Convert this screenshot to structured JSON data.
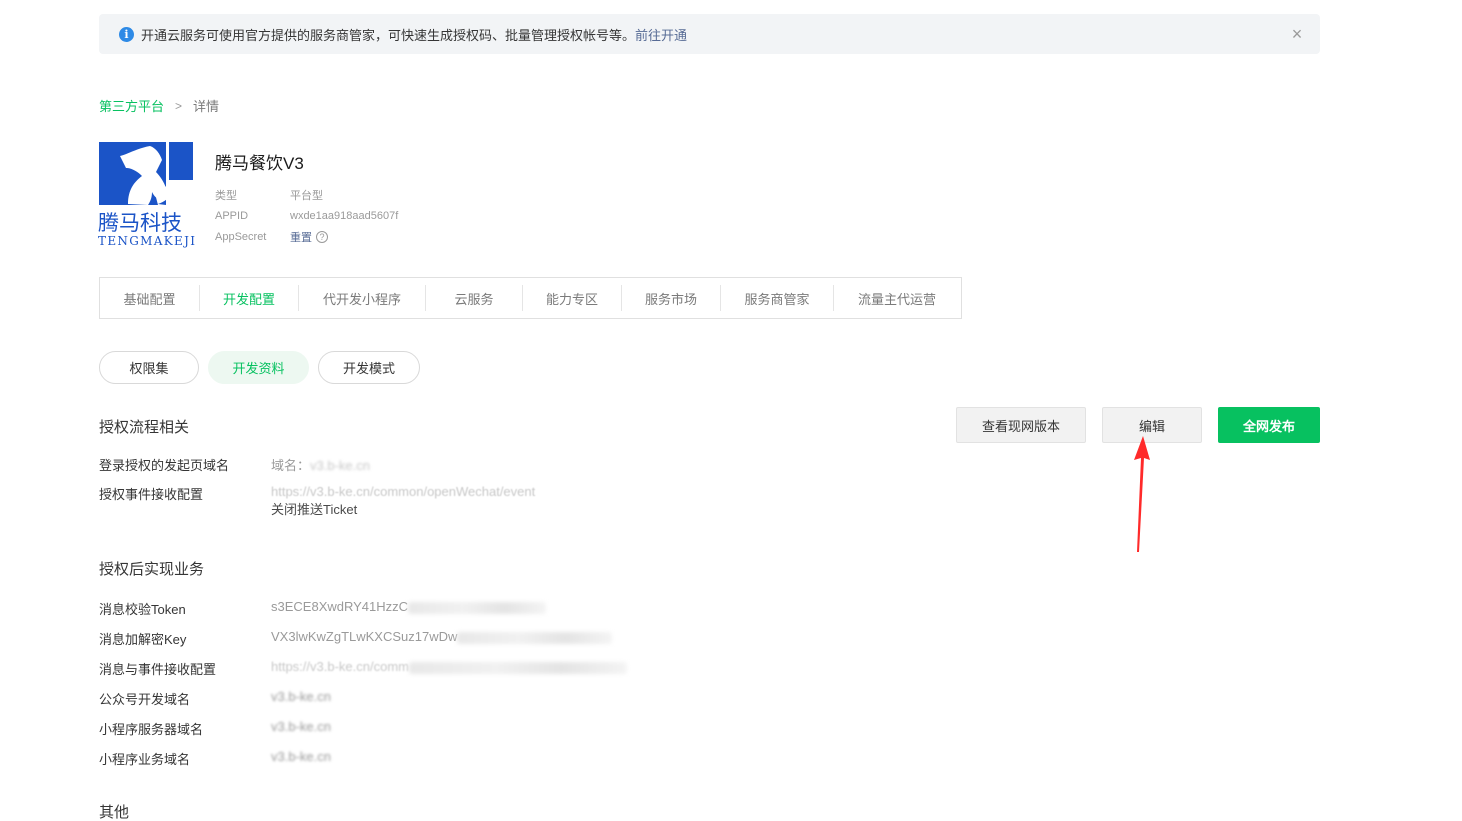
{
  "notice": {
    "text": "开通云服务可使用官方提供的服务商管家，可快速生成授权码、批量管理授权帐号等。",
    "link": "前往开通",
    "close": "×"
  },
  "breadcrumb": {
    "parent": "第三方平台",
    "sep": ">",
    "current": "详情"
  },
  "logo": {
    "line1": "腾马科技",
    "line2": "TENGMAKEJI"
  },
  "app": {
    "name": "腾马餐饮V3",
    "meta": [
      {
        "key": "类型",
        "value": "平台型"
      },
      {
        "key": "APPID",
        "value": "wxde1aa918aad5607f"
      },
      {
        "key": "AppSecret",
        "value": "重置"
      }
    ]
  },
  "tabs": [
    "基础配置",
    "开发配置",
    "代开发小程序",
    "云服务",
    "能力专区",
    "服务市场",
    "服务商管家",
    "流量主代运营"
  ],
  "pills": [
    "权限集",
    "开发资料",
    "开发模式"
  ],
  "sections": {
    "auth_flow": "授权流程相关",
    "after_auth": "授权后实现业务",
    "other": "其他"
  },
  "buttons": {
    "view_live": "查看现网版本",
    "edit": "编辑",
    "publish": "全网发布"
  },
  "auth_rows": [
    {
      "label": "登录授权的发起页域名",
      "prefix": "域名：",
      "value": "v3.b-ke.cn"
    },
    {
      "label": "授权事件接收配置",
      "value": "https://v3.b-ke.cn/common/openWechat/event",
      "extra": "关闭推送Ticket"
    }
  ],
  "biz_rows": [
    {
      "label": "消息校验Token",
      "value": "s3ECE8XwdRY41HzzC"
    },
    {
      "label": "消息加解密Key",
      "value": "VX3lwKwZgTLwKXCSuz17wDw"
    },
    {
      "label": "消息与事件接收配置",
      "value": "https://v3.b-ke.cn/comm"
    },
    {
      "label": "公众号开发域名",
      "value": "v3.b-ke.cn"
    },
    {
      "label": "小程序服务器域名",
      "value": "v3.b-ke.cn"
    },
    {
      "label": "小程序业务域名",
      "value": "v3.b-ke.cn"
    }
  ],
  "colors": {
    "accent": "#07c160",
    "link": "#576b95",
    "annotation": "#ff2a2a"
  },
  "icons": {
    "info": "info-icon",
    "close": "close-icon",
    "help": "help-icon"
  }
}
